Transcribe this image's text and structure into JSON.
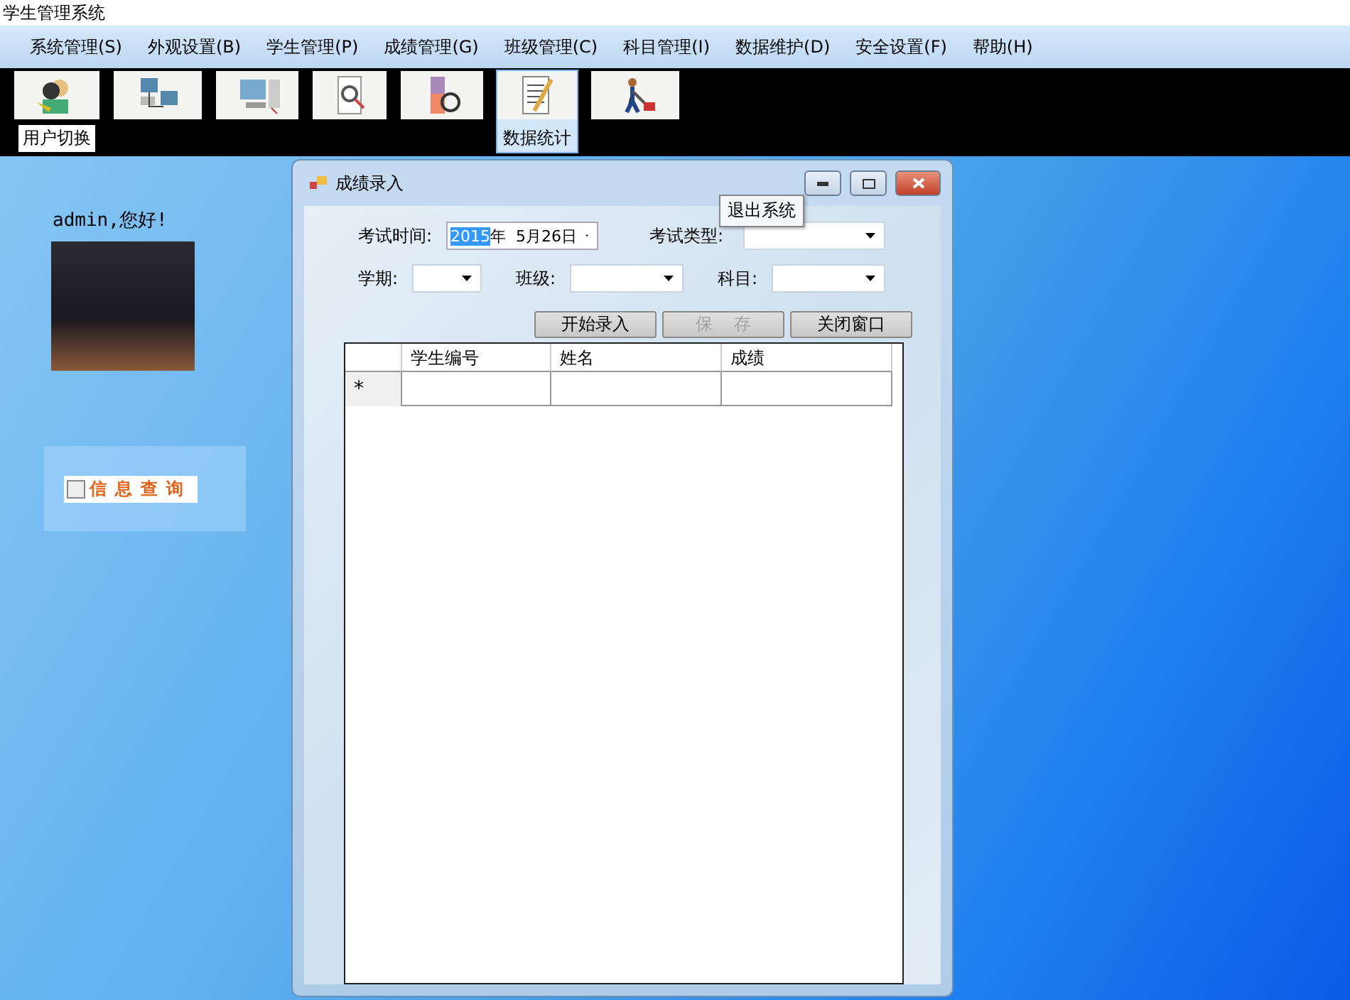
{
  "window": {
    "title": "学生管理系统"
  },
  "menu": [
    "系统管理(S)",
    "外观设置(B)",
    "学生管理(P)",
    "成绩管理(G)",
    "班级管理(C)",
    "科目管理(I)",
    "数据维护(D)",
    "安全设置(F)",
    "帮助(H)"
  ],
  "toolbar": [
    {
      "label": "用户切换",
      "hovered": false
    },
    {
      "hovered": false
    },
    {
      "hovered": false
    },
    {
      "hovered": false
    },
    {
      "hovered": false
    },
    {
      "label": "数据统计",
      "hovered": true
    },
    {
      "hovered": false
    }
  ],
  "sidebar": {
    "greeting": "admin,您好!",
    "query": {
      "label": "信息查询",
      "checked": false
    }
  },
  "tooltip": "退出系统",
  "dialog": {
    "title": "成绩录入",
    "exam_date": {
      "label": "考试时间:",
      "year": "2015",
      "rest": "年  5月26日"
    },
    "exam_type": {
      "label": "考试类型:"
    },
    "term": {
      "label": "学期:"
    },
    "class": {
      "label": "班级:"
    },
    "subject": {
      "label": "科目:"
    },
    "buttons": [
      {
        "label": "开始录入",
        "disabled": false
      },
      {
        "label": "保    存",
        "disabled": true
      },
      {
        "label": "关闭窗口",
        "disabled": false
      }
    ],
    "table": {
      "columns": [
        "学生编号",
        "姓名",
        "成绩"
      ],
      "new_row_marker": "*"
    }
  }
}
